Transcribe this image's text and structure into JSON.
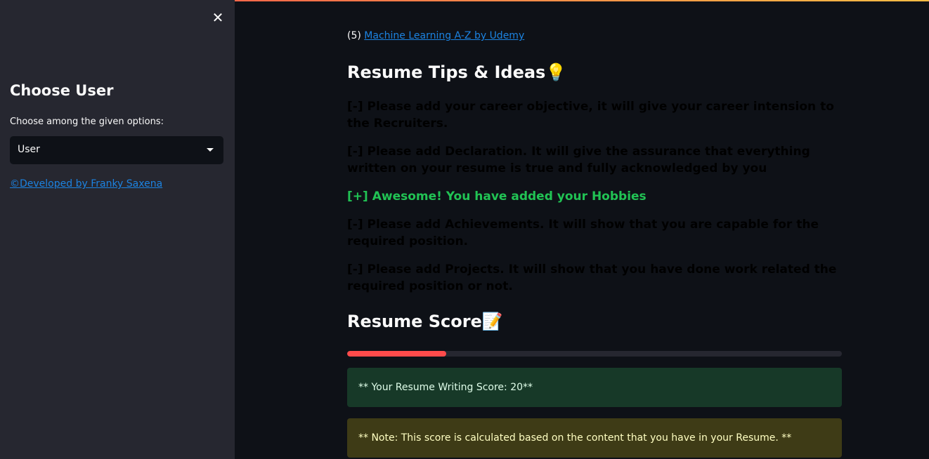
{
  "sidebar": {
    "close_label": "✕",
    "title": "Choose User",
    "select_label": "Choose among the given options:",
    "select_value": "User",
    "credit_link": "©Developed by Franky Saxena"
  },
  "main": {
    "course_prefix": "(5)",
    "course_link": "Machine Learning A-Z by Udemy",
    "tips_heading": "Resume Tips & Ideas💡",
    "tips": [
      {
        "text": "[-] Please add your career objective, it will give your career intension to the Recruiters.",
        "status": "missing"
      },
      {
        "text": "[-] Please add Declaration. It will give the assurance that everything written on your resume is true and fully acknowledged by you",
        "status": "missing"
      },
      {
        "text": "[+] Awesome! You have added your Hobbies",
        "status": "added"
      },
      {
        "text": "[-] Please add Achievements. It will show that you are capable for the required position.",
        "status": "missing"
      },
      {
        "text": "[-] Please add Projects. It will show that you have done work related the required position or not.",
        "status": "missing"
      }
    ],
    "score_heading": "Resume Score📝",
    "score_progress_percent": 20,
    "score_message": "** Your Resume Writing Score: 20**",
    "note_message": "** Note: This score is calculated based on the content that you have in your Resume. **"
  },
  "colors": {
    "background": "#0e1117",
    "sidebar": "#262730",
    "link": "#1c83e1",
    "progress": "#ff4b4b",
    "good_tip": "#21c354"
  }
}
